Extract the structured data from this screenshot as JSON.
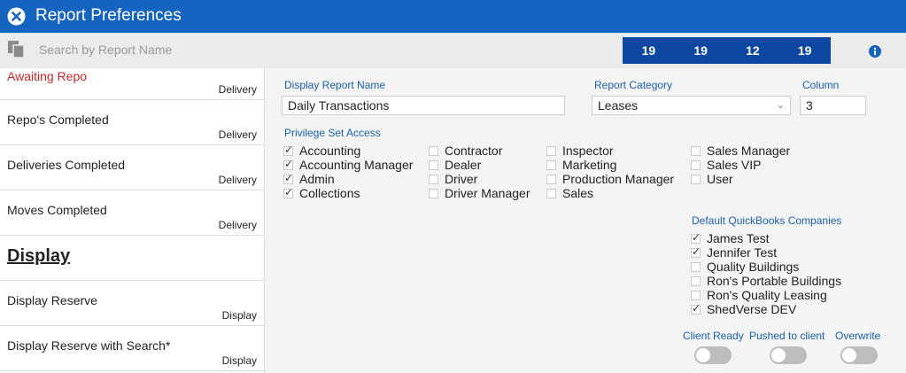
{
  "window": {
    "title": "Report Preferences"
  },
  "toolbar": {
    "search_placeholder": "Search by Report Name",
    "counters": [
      "19",
      "19",
      "12",
      "19"
    ]
  },
  "sidebar": {
    "items": [
      {
        "name": "Awaiting Repo",
        "category": "Delivery"
      },
      {
        "name": "Repo's Completed",
        "category": "Delivery"
      },
      {
        "name": "Deliveries Completed",
        "category": "Delivery"
      },
      {
        "name": "Moves Completed",
        "category": "Delivery"
      },
      {
        "name": "Display",
        "category": ""
      },
      {
        "name": "Display Reserve",
        "category": "Display"
      },
      {
        "name": "Display Reserve with Search*",
        "category": "Display"
      }
    ]
  },
  "form": {
    "display_name_label": "Display Report Name",
    "display_name_value": "Daily Transactions",
    "category_label": "Report Category",
    "category_value": "Leases",
    "column_label": "Column",
    "column_value": "3",
    "privilege_label": "Privilege Set Access",
    "privileges": [
      [
        {
          "label": "Accounting",
          "checked": true
        },
        {
          "label": "Accounting Manager",
          "checked": true
        },
        {
          "label": "Admin",
          "checked": true
        },
        {
          "label": "Collections",
          "checked": true
        }
      ],
      [
        {
          "label": "Contractor",
          "checked": false
        },
        {
          "label": "Dealer",
          "checked": false
        },
        {
          "label": "Driver",
          "checked": false
        },
        {
          "label": "Driver Manager",
          "checked": false
        }
      ],
      [
        {
          "label": "Inspector",
          "checked": false
        },
        {
          "label": "Marketing",
          "checked": false
        },
        {
          "label": "Production Manager",
          "checked": false
        },
        {
          "label": "Sales",
          "checked": false
        }
      ],
      [
        {
          "label": "Sales Manager",
          "checked": false
        },
        {
          "label": "Sales VIP",
          "checked": false
        },
        {
          "label": "User",
          "checked": false
        }
      ]
    ],
    "companies_label": "Default QuickBooks Companies",
    "companies": [
      {
        "label": "James Test",
        "checked": true
      },
      {
        "label": "Jennifer Test",
        "checked": true
      },
      {
        "label": "Quality Buildings",
        "checked": false
      },
      {
        "label": "Ron's Portable Buildings",
        "checked": false
      },
      {
        "label": "Ron's Quality Leasing",
        "checked": false
      },
      {
        "label": "ShedVerse DEV",
        "checked": true
      }
    ],
    "toggles": [
      {
        "label": "Client Ready",
        "on": false
      },
      {
        "label": "Pushed to client",
        "on": false
      },
      {
        "label": "Overwrite",
        "on": false
      }
    ]
  },
  "colors": {
    "title_bar": "#1565c0",
    "counter_bar": "#0d47a1",
    "label_blue": "#1a5fa8",
    "first_item_red": "#c62828"
  }
}
